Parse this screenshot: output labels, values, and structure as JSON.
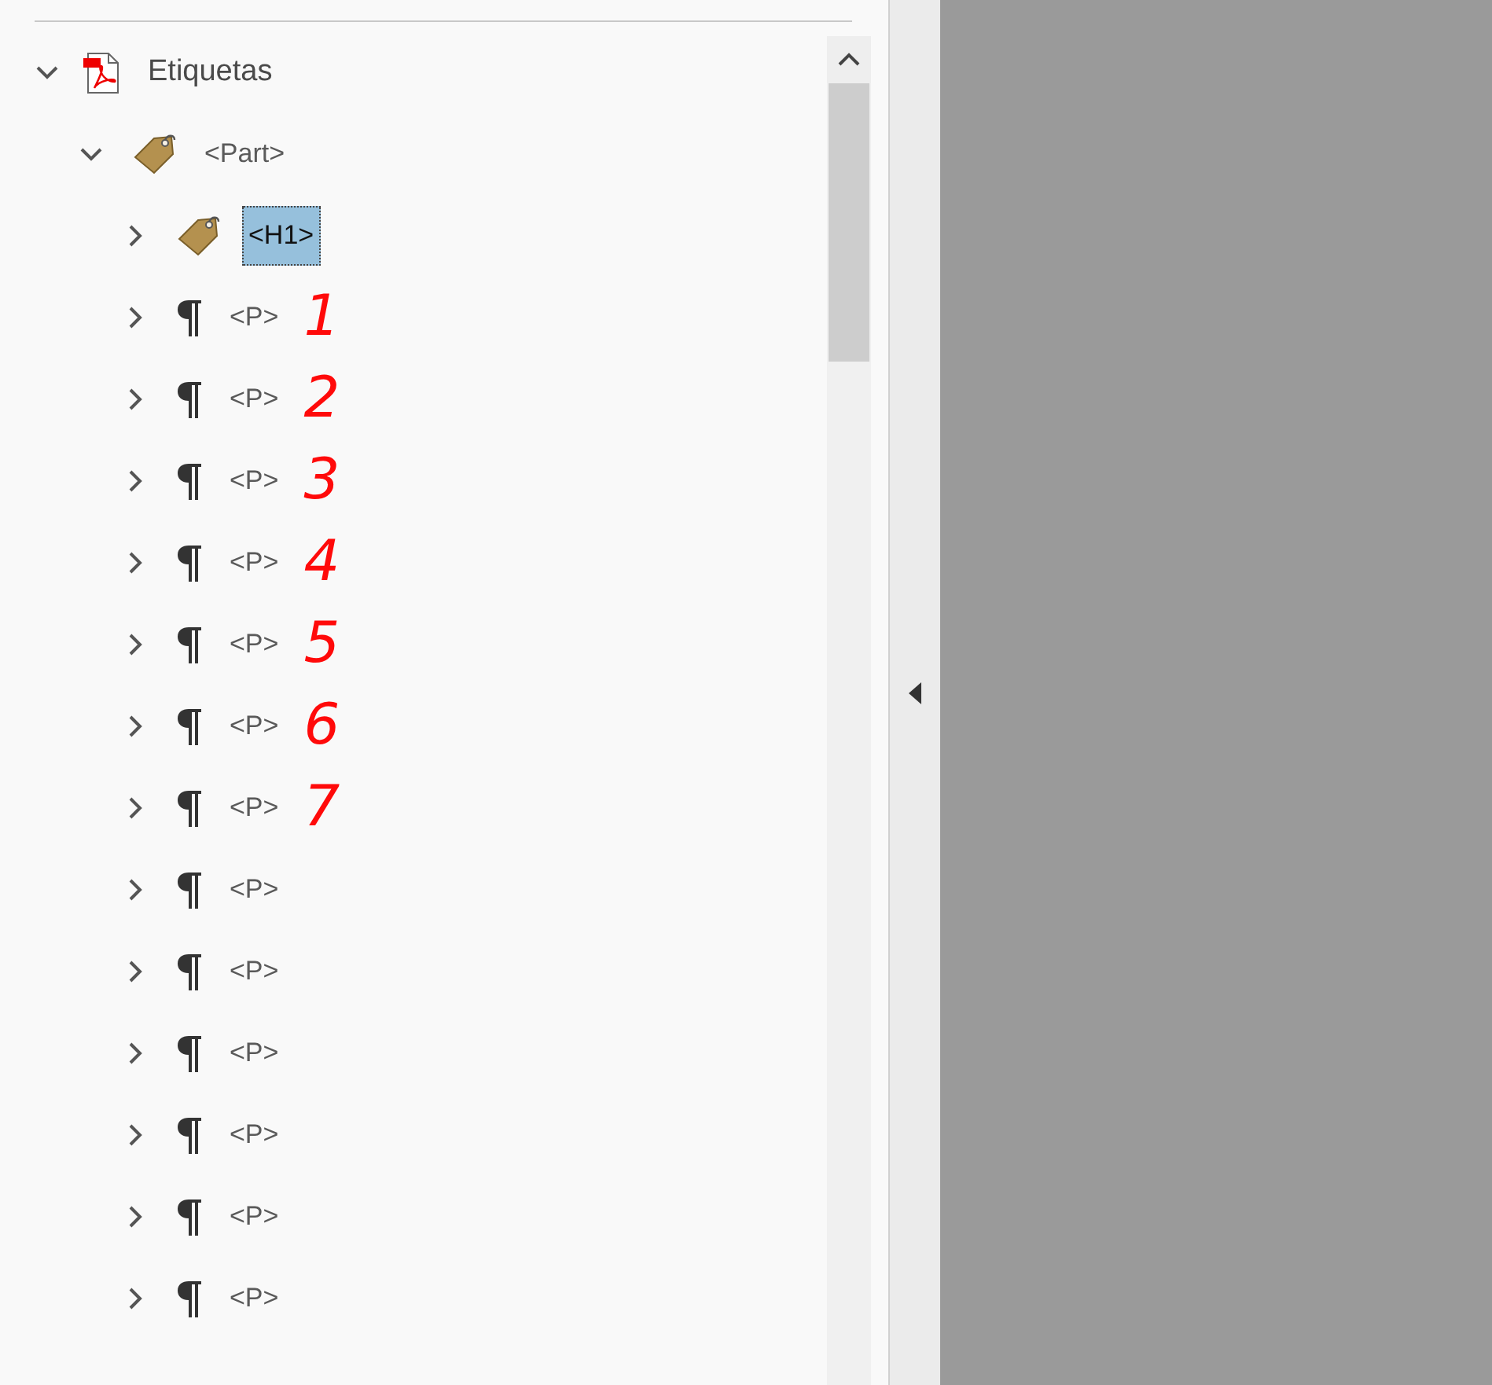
{
  "tags_panel": {
    "tree": [
      {
        "label": "Etiquetas",
        "kind": "document",
        "expanded": true,
        "selected": false,
        "children": [
          {
            "label": "<Part>",
            "kind": "tag",
            "expanded": true,
            "selected": false,
            "children": [
              {
                "label": "<H1>",
                "kind": "tag",
                "expanded": false,
                "selected": true
              },
              {
                "label": "<P>",
                "kind": "paragraph",
                "expanded": false,
                "selected": false,
                "annotation": "1"
              },
              {
                "label": "<P>",
                "kind": "paragraph",
                "expanded": false,
                "selected": false,
                "annotation": "2"
              },
              {
                "label": "<P>",
                "kind": "paragraph",
                "expanded": false,
                "selected": false,
                "annotation": "3"
              },
              {
                "label": "<P>",
                "kind": "paragraph",
                "expanded": false,
                "selected": false,
                "annotation": "4"
              },
              {
                "label": "<P>",
                "kind": "paragraph",
                "expanded": false,
                "selected": false,
                "annotation": "5"
              },
              {
                "label": "<P>",
                "kind": "paragraph",
                "expanded": false,
                "selected": false,
                "annotation": "6"
              },
              {
                "label": "<P>",
                "kind": "paragraph",
                "expanded": false,
                "selected": false,
                "annotation": "7"
              },
              {
                "label": "<P>",
                "kind": "paragraph",
                "expanded": false,
                "selected": false
              },
              {
                "label": "<P>",
                "kind": "paragraph",
                "expanded": false,
                "selected": false
              },
              {
                "label": "<P>",
                "kind": "paragraph",
                "expanded": false,
                "selected": false
              },
              {
                "label": "<P>",
                "kind": "paragraph",
                "expanded": false,
                "selected": false
              },
              {
                "label": "<P>",
                "kind": "paragraph",
                "expanded": false,
                "selected": false
              },
              {
                "label": "<P>",
                "kind": "paragraph",
                "expanded": false,
                "selected": false
              }
            ]
          }
        ]
      }
    ]
  }
}
